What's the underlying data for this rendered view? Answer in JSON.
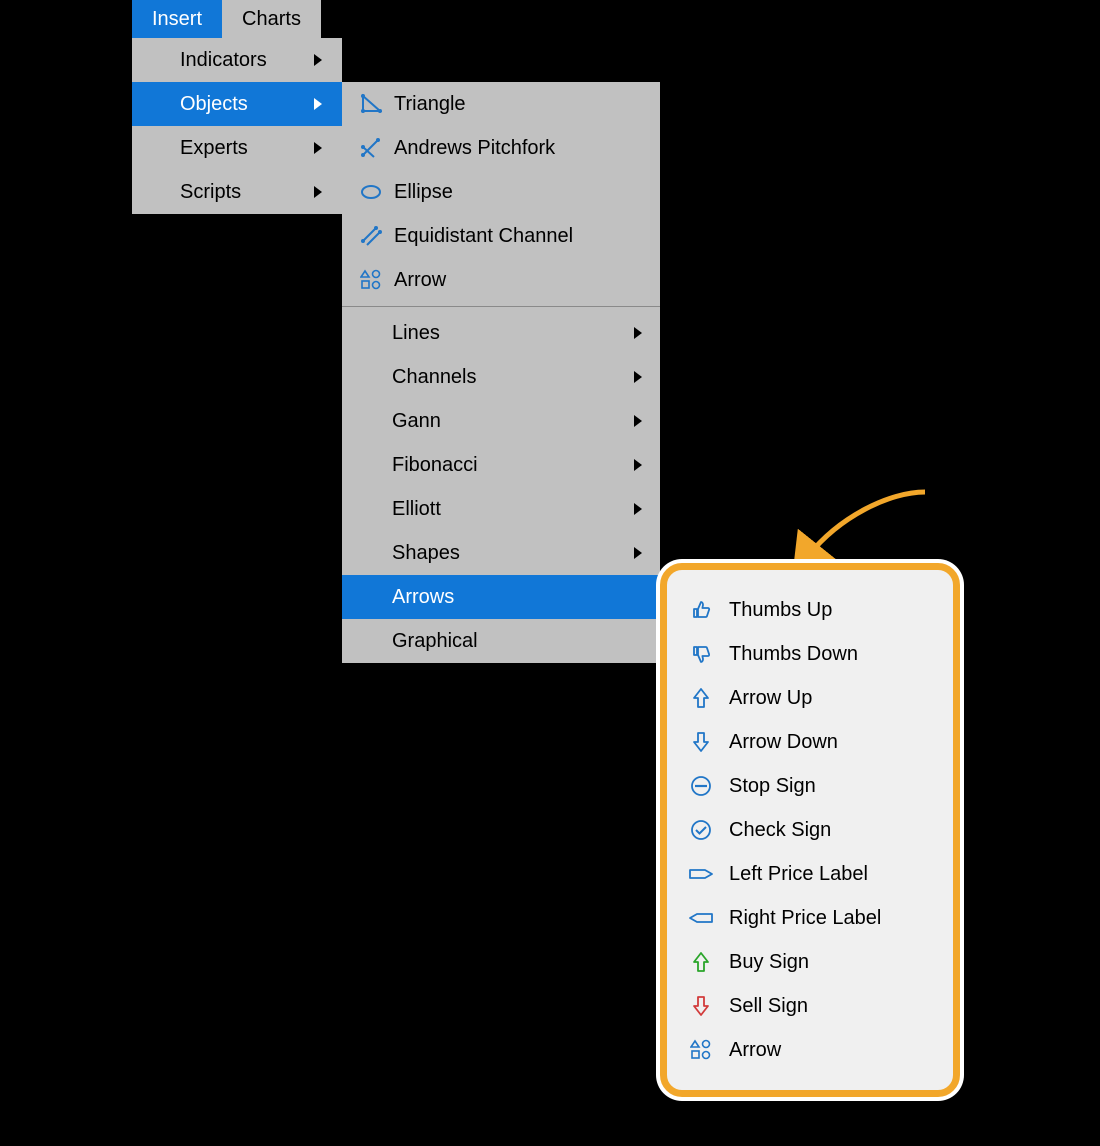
{
  "tabs": {
    "insert": "Insert",
    "charts": "Charts"
  },
  "menu1": {
    "indicators": "Indicators",
    "objects": "Objects",
    "experts": "Experts",
    "scripts": "Scripts"
  },
  "menu2": {
    "triangle": "Triangle",
    "andrews": "Andrews Pitchfork",
    "ellipse": "Ellipse",
    "equidistant": "Equidistant Channel",
    "arrow": "Arrow",
    "lines": "Lines",
    "channels": "Channels",
    "gann": "Gann",
    "fibonacci": "Fibonacci",
    "elliott": "Elliott",
    "shapes": "Shapes",
    "arrows": "Arrows",
    "graphical": "Graphical"
  },
  "callout": {
    "thumbs_up": "Thumbs Up",
    "thumbs_down": "Thumbs Down",
    "arrow_up": "Arrow Up",
    "arrow_down": "Arrow Down",
    "stop_sign": "Stop Sign",
    "check_sign": "Check Sign",
    "left_price": "Left Price Label",
    "right_price": "Right Price Label",
    "buy_sign": "Buy Sign",
    "sell_sign": "Sell Sign",
    "arrow": "Arrow"
  }
}
